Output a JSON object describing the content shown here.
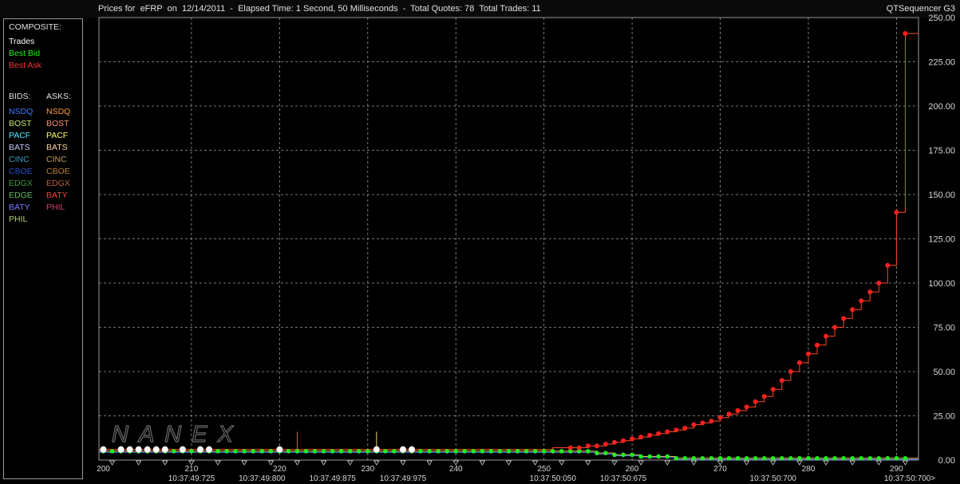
{
  "window": {
    "title": "Prices for  eFRP  on  12/14/2011  -  Elapsed Time: 1 Second, 50 Milliseconds  -  Total Quotes: 78  Total Trades: 11",
    "app_name": "QTSequencer G3"
  },
  "legend": {
    "composite_header": "COMPOSITE:",
    "trades_label": "Trades",
    "best_bid_label": "Best Bid",
    "best_ask_label": "Best Ask",
    "bids_header": "BIDS:",
    "asks_header": "ASKS:",
    "bids": [
      {
        "label": "NSDQ",
        "color": "#3d7bff"
      },
      {
        "label": "BOST",
        "color": "#c8e87a"
      },
      {
        "label": "PACF",
        "color": "#4ff0ff"
      },
      {
        "label": "BATS",
        "color": "#c8c8ff"
      },
      {
        "label": "CINC",
        "color": "#3aa0c0"
      },
      {
        "label": "CBOE",
        "color": "#2a4fc8"
      },
      {
        "label": "EDGX",
        "color": "#3c9a3c"
      },
      {
        "label": "EDGE",
        "color": "#60c060"
      },
      {
        "label": "BATY",
        "color": "#7b7bff"
      },
      {
        "label": "PHIL",
        "color": "#b0d070"
      }
    ],
    "asks": [
      {
        "label": "NSDQ",
        "color": "#ff9a3d"
      },
      {
        "label": "BOST",
        "color": "#ff8a70"
      },
      {
        "label": "PACF",
        "color": "#ffff60"
      },
      {
        "label": "BATS",
        "color": "#ffd2a0"
      },
      {
        "label": "CINC",
        "color": "#c8a060"
      },
      {
        "label": "CBOE",
        "color": "#c08030"
      },
      {
        "label": "EDGX",
        "color": "#c06040"
      },
      {
        "label": "BATY",
        "color": "#ff4040"
      },
      {
        "label": "PHIL",
        "color": "#d04070"
      }
    ]
  },
  "watermark": "NANEX",
  "colors": {
    "best_bid": "#22ee22",
    "best_ask": "#ff2020",
    "ask_step": "#ff4a20",
    "bid_step": "#ffb050",
    "trade": "#ffffff",
    "grid": "#9a9a9a"
  },
  "chart_data": {
    "type": "line",
    "title": "",
    "x_ticks": [
      200,
      210,
      220,
      230,
      240,
      250,
      260,
      270,
      280,
      290
    ],
    "x_time_labels": [
      {
        "at": 210,
        "label": "10:37:49:725"
      },
      {
        "at": 218,
        "label": "10:37:49:800"
      },
      {
        "at": 226,
        "label": "10:37:49:875"
      },
      {
        "at": 234,
        "label": "10:37:49:975"
      },
      {
        "at": 251,
        "label": "10:37:50:050"
      },
      {
        "at": 259,
        "label": "10:37:50:675"
      },
      {
        "at": 276,
        "label": "10:37:50:700"
      },
      {
        "at": 292,
        "label": "10:37:50:700>"
      }
    ],
    "y_ticks": [
      "0.00",
      "25.00",
      "50.00",
      "75.00",
      "100.00",
      "125.00",
      "150.00",
      "175.00",
      "200.00",
      "225.00",
      "250.00"
    ],
    "xlim": [
      199.5,
      292.5
    ],
    "ylim": [
      0,
      250
    ],
    "grid": true,
    "series": [
      {
        "name": "Best Ask",
        "x": [
          200,
          201,
          202,
          203,
          204,
          205,
          206,
          207,
          208,
          209,
          210,
          211,
          212,
          213,
          214,
          215,
          216,
          217,
          218,
          219,
          220,
          221,
          222,
          223,
          224,
          225,
          226,
          227,
          228,
          229,
          230,
          231,
          232,
          233,
          234,
          235,
          236,
          237,
          238,
          239,
          240,
          241,
          242,
          243,
          244,
          245,
          246,
          247,
          248,
          249,
          250,
          251,
          252,
          253,
          254,
          255,
          256,
          257,
          258,
          259,
          260,
          261,
          262,
          263,
          264,
          265,
          266,
          267,
          268,
          269,
          270,
          271,
          272,
          273,
          274,
          275,
          276,
          277,
          278,
          279,
          280,
          281,
          282,
          283,
          284,
          285,
          286,
          287,
          288,
          289,
          290,
          291
        ],
        "y": [
          6,
          6,
          6,
          6,
          6,
          6,
          6,
          6,
          6,
          6,
          6,
          6,
          6,
          6,
          6,
          6,
          6,
          6,
          6,
          6,
          6,
          6,
          6,
          6,
          6,
          6,
          6,
          6,
          6,
          6,
          6,
          6,
          6,
          6,
          6,
          6,
          6,
          6,
          6,
          6,
          6,
          6,
          6,
          6,
          6,
          6,
          6,
          6,
          6,
          6,
          6,
          7,
          7,
          7,
          7,
          8,
          8,
          9,
          10,
          11,
          12,
          13,
          14,
          15,
          16,
          17,
          18,
          20,
          21,
          22,
          24,
          26,
          28,
          30,
          33,
          36,
          40,
          45,
          50,
          55,
          60,
          65,
          70,
          75,
          80,
          85,
          90,
          95,
          100,
          110,
          140,
          241
        ]
      },
      {
        "name": "Best Bid",
        "x": [
          200,
          201,
          202,
          203,
          204,
          205,
          206,
          207,
          208,
          209,
          210,
          211,
          212,
          213,
          214,
          215,
          216,
          217,
          218,
          219,
          220,
          221,
          222,
          223,
          224,
          225,
          226,
          227,
          228,
          229,
          230,
          231,
          232,
          233,
          234,
          235,
          236,
          237,
          238,
          239,
          240,
          241,
          242,
          243,
          244,
          245,
          246,
          247,
          248,
          249,
          250,
          251,
          252,
          253,
          254,
          255,
          256,
          257,
          258,
          259,
          260,
          261,
          262,
          263,
          264,
          265,
          266,
          267,
          268,
          269,
          270,
          271,
          272,
          273,
          274,
          275,
          276,
          277,
          278,
          279,
          280,
          281,
          282,
          283,
          284,
          285,
          286,
          287,
          288,
          289,
          290,
          291
        ],
        "y": [
          5,
          5,
          5,
          5,
          5,
          5,
          5,
          5,
          5,
          5,
          5,
          5,
          5,
          5,
          5,
          5,
          5,
          5,
          5,
          5,
          5,
          5,
          5,
          5,
          5,
          5,
          5,
          5,
          5,
          5,
          5,
          5,
          5,
          5,
          5,
          5,
          5,
          5,
          5,
          5,
          5,
          5,
          5,
          5,
          5,
          5,
          5,
          5,
          5,
          5,
          5,
          5,
          5,
          5,
          5,
          5,
          4,
          4,
          3,
          3,
          3,
          2,
          2,
          2,
          2,
          1,
          1,
          1,
          1,
          1,
          1,
          1,
          1,
          1,
          1,
          1,
          1,
          1,
          1,
          1,
          1,
          1,
          1,
          1,
          1,
          1,
          1,
          1,
          1,
          1,
          1,
          1
        ]
      },
      {
        "name": "Trades",
        "x": [
          200,
          202,
          203,
          204,
          205,
          206,
          207,
          209,
          211,
          212,
          220,
          231,
          234,
          235
        ],
        "y": [
          6,
          6,
          6,
          6,
          6,
          6,
          6,
          6,
          6,
          6,
          6,
          6,
          6,
          6
        ]
      }
    ]
  }
}
